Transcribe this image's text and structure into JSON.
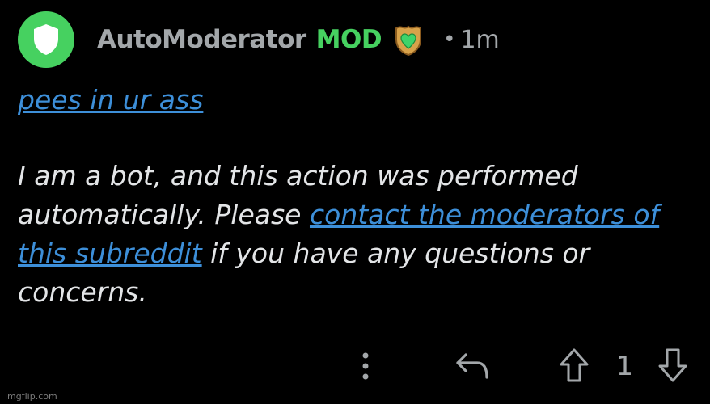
{
  "comment": {
    "author": "AutoModerator",
    "mod_label": "MOD",
    "separator": "•",
    "time": "1m",
    "avatar_icon": "shield-icon",
    "flair_icon": "heart-shield-icon",
    "link_text": "pees in ur ass",
    "body": {
      "part1": "I am a bot, and this action was performed automatically. Please ",
      "link": "contact the moderators of this subreddit",
      "part2": " if you have any questions or concerns."
    },
    "score": "1"
  },
  "icons": {
    "more": "more-vertical-icon",
    "reply": "reply-arrow-icon",
    "upvote": "upvote-arrow-icon",
    "downvote": "downvote-arrow-icon"
  },
  "colors": {
    "background": "#000000",
    "avatar": "#46d160",
    "mod": "#46d160",
    "link": "#3d8fd9",
    "meta": "#a3a7aa",
    "text": "#e3e5e7"
  },
  "watermark": "imgflip.com"
}
